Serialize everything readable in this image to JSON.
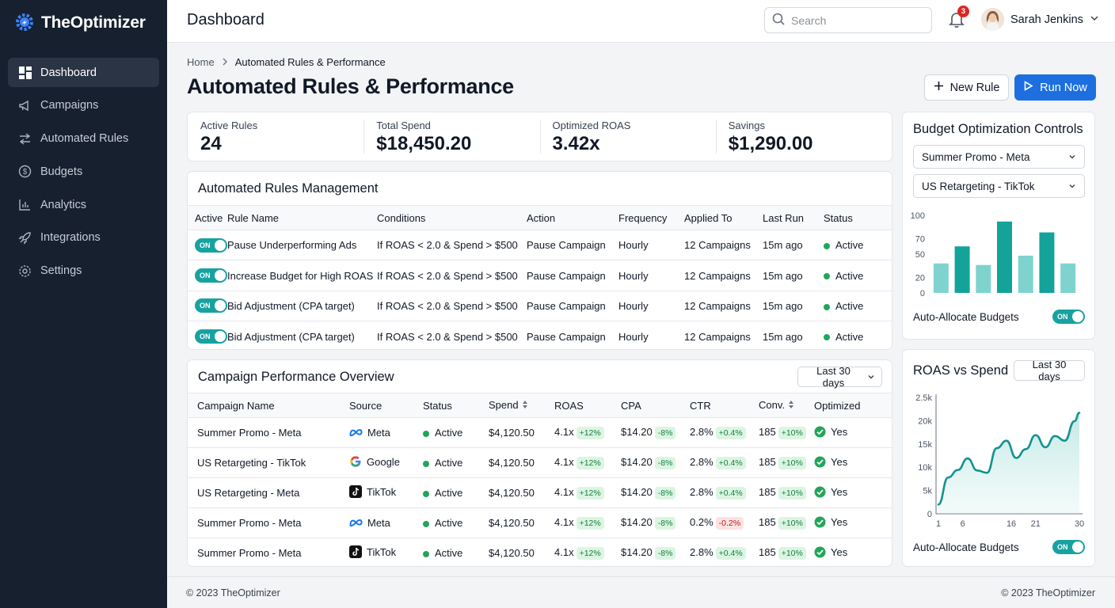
{
  "brand": {
    "name": "TheOptimizer"
  },
  "sidebar": {
    "items": [
      {
        "label": "Dashboard",
        "icon": "dashboard-icon",
        "active": true
      },
      {
        "label": "Campaigns",
        "icon": "megaphone-icon"
      },
      {
        "label": "Automated Rules",
        "icon": "swap-arrows-icon"
      },
      {
        "label": "Budgets",
        "icon": "dollar-circle-icon"
      },
      {
        "label": "Analytics",
        "icon": "bar-chart-icon"
      },
      {
        "label": "Integrations",
        "icon": "rocket-icon"
      },
      {
        "label": "Settings",
        "icon": "gear-icon"
      }
    ]
  },
  "header": {
    "title": "Dashboard",
    "search_placeholder": "Search",
    "notification_count": "3",
    "user_name": "Sarah Jenkins"
  },
  "breadcrumb": {
    "home": "Home",
    "current": "Automated Rules & Performance"
  },
  "page": {
    "title": "Automated Rules & Performance",
    "new_rule_label": "New Rule",
    "run_now_label": "Run Now"
  },
  "kpis": [
    {
      "label": "Active Rules",
      "value": "24"
    },
    {
      "label": "Total Spend",
      "value": "$18,450.20"
    },
    {
      "label": "Optimized ROAS",
      "value": "3.42x"
    },
    {
      "label": "Savings",
      "value": "$1,290.00"
    }
  ],
  "rules": {
    "title": "Automated Rules Management",
    "columns": [
      "Active",
      "Rule Name",
      "Conditions",
      "Action",
      "Frequency",
      "Applied To",
      "Last Run",
      "Status"
    ],
    "rows": [
      {
        "toggle": "ON",
        "name": "Pause Underperforming Ads",
        "conditions": "If ROAS < 2.0 & Spend > $500",
        "action": "Pause Campaign",
        "frequency": "Hourly",
        "applied_to": "12 Campaigns",
        "last_run": "15m ago",
        "status": "Active"
      },
      {
        "toggle": "ON",
        "name": "Increase Budget for High ROAS",
        "conditions": "If ROAS < 2.0 & Spend > $500",
        "action": "Pause Campaign",
        "frequency": "Hourly",
        "applied_to": "12 Campaigns",
        "last_run": "15m ago",
        "status": "Active"
      },
      {
        "toggle": "ON",
        "name": "Bid Adjustment (CPA target)",
        "conditions": "If ROAS < 2.0 & Spend > $500",
        "action": "Pause Campaign",
        "frequency": "Hourly",
        "applied_to": "12 Campaigns",
        "last_run": "15m ago",
        "status": "Active"
      },
      {
        "toggle": "ON",
        "name": "Bid Adjustment (CPA target)",
        "conditions": "If ROAS < 2.0 & Spend > $500",
        "action": "Pause Campaign",
        "frequency": "Hourly",
        "applied_to": "12 Campaigns",
        "last_run": "15m ago",
        "status": "Active"
      }
    ]
  },
  "performance": {
    "title": "Campaign Performance Overview",
    "range": "Last 30 days",
    "columns": [
      "Campaign Name",
      "Source",
      "Status",
      "Spend",
      "ROAS",
      "CPA",
      "CTR",
      "Conv.",
      "Optimized"
    ],
    "rows": [
      {
        "name": "Summer Promo - Meta",
        "source": "Meta",
        "source_icon": "meta-icon",
        "status": "Active",
        "spend": "$4,120.50",
        "roas": "4.1x",
        "roas_delta": "+12%",
        "cpa": "$14.20",
        "cpa_delta": "-8%",
        "ctr": "2.8%",
        "ctr_delta": "+0.4%",
        "ctr_delta_dir": "up",
        "conv": "185",
        "conv_delta": "+10%",
        "optimized": "Yes"
      },
      {
        "name": "US Retargeting - TikTok",
        "source": "Google",
        "source_icon": "google-icon",
        "status": "Active",
        "spend": "$4,120.50",
        "roas": "4.1x",
        "roas_delta": "+12%",
        "cpa": "$14.20",
        "cpa_delta": "-8%",
        "ctr": "2.8%",
        "ctr_delta": "+0.4%",
        "ctr_delta_dir": "up",
        "conv": "185",
        "conv_delta": "+10%",
        "optimized": "Yes"
      },
      {
        "name": "US Retargeting - Meta",
        "source": "TikTok",
        "source_icon": "tiktok-icon",
        "status": "Active",
        "spend": "$4,120.50",
        "roas": "4.1x",
        "roas_delta": "+12%",
        "cpa": "$14.20",
        "cpa_delta": "-8%",
        "ctr": "2.8%",
        "ctr_delta": "+0.4%",
        "ctr_delta_dir": "up",
        "conv": "185",
        "conv_delta": "+10%",
        "optimized": "Yes"
      },
      {
        "name": "Summer Promo - Meta",
        "source": "Meta",
        "source_icon": "meta-icon",
        "status": "Active",
        "spend": "$4,120.50",
        "roas": "4.1x",
        "roas_delta": "+12%",
        "cpa": "$14.20",
        "cpa_delta": "-8%",
        "ctr": "0.2%",
        "ctr_delta": "-0.2%",
        "ctr_delta_dir": "down",
        "conv": "185",
        "conv_delta": "+10%",
        "optimized": "Yes"
      },
      {
        "name": "Summer Promo - Meta",
        "source": "TikTok",
        "source_icon": "tiktok-icon",
        "status": "Active",
        "spend": "$4,120.50",
        "roas": "4.1x",
        "roas_delta": "+12%",
        "cpa": "$14.20",
        "cpa_delta": "-8%",
        "ctr": "2.8%",
        "ctr_delta": "+0.4%",
        "ctr_delta_dir": "up",
        "conv": "185",
        "conv_delta": "+10%",
        "optimized": "Yes"
      }
    ]
  },
  "budget_panel": {
    "title": "Budget Optimization Controls",
    "select_1": "Summer Promo - Meta",
    "select_2": "US Retargeting - TikTok",
    "toggle_label": "Auto-Allocate Budgets",
    "toggle_state": "ON"
  },
  "roas_panel": {
    "title": "ROAS vs Spend",
    "range": "Last 30 days",
    "toggle_label": "Auto-Allocate Budgets",
    "toggle_state": "ON"
  },
  "chart_data": [
    {
      "type": "bar",
      "ylim": [
        0,
        100
      ],
      "yticks": [
        "0",
        "20",
        "50",
        "70",
        "100"
      ],
      "ytick_values": [
        0,
        20,
        50,
        70,
        100
      ],
      "values": [
        38,
        60,
        36,
        92,
        48,
        78,
        38
      ],
      "colors": [
        "#7fd3cf",
        "#13a39a",
        "#7fd3cf",
        "#13a39a",
        "#7fd3cf",
        "#13a39a",
        "#7fd3cf"
      ]
    },
    {
      "type": "area",
      "x": [
        1,
        3,
        5,
        7,
        9,
        11,
        13,
        15,
        17,
        19,
        21,
        23,
        25,
        27,
        29,
        30
      ],
      "y": [
        2000,
        7800,
        9400,
        11900,
        9300,
        8800,
        14100,
        15700,
        12000,
        13900,
        16900,
        14300,
        16700,
        15700,
        19900,
        21700
      ],
      "xticks": [
        "1",
        "6",
        "16",
        "21",
        "30"
      ],
      "xtick_values": [
        1,
        6,
        16,
        21,
        30
      ],
      "yticks": [
        "0",
        "5k",
        "10k",
        "15k",
        "20k",
        "2.5k"
      ],
      "ytick_values": [
        0,
        5000,
        10000,
        15000,
        20000,
        25000
      ],
      "ylim": [
        0,
        25000
      ],
      "xlim": [
        1,
        30
      ],
      "color": "#13938f"
    }
  ],
  "footer": {
    "left": "© 2023 TheOptimizer",
    "right": "© 2023 TheOptimizer"
  }
}
